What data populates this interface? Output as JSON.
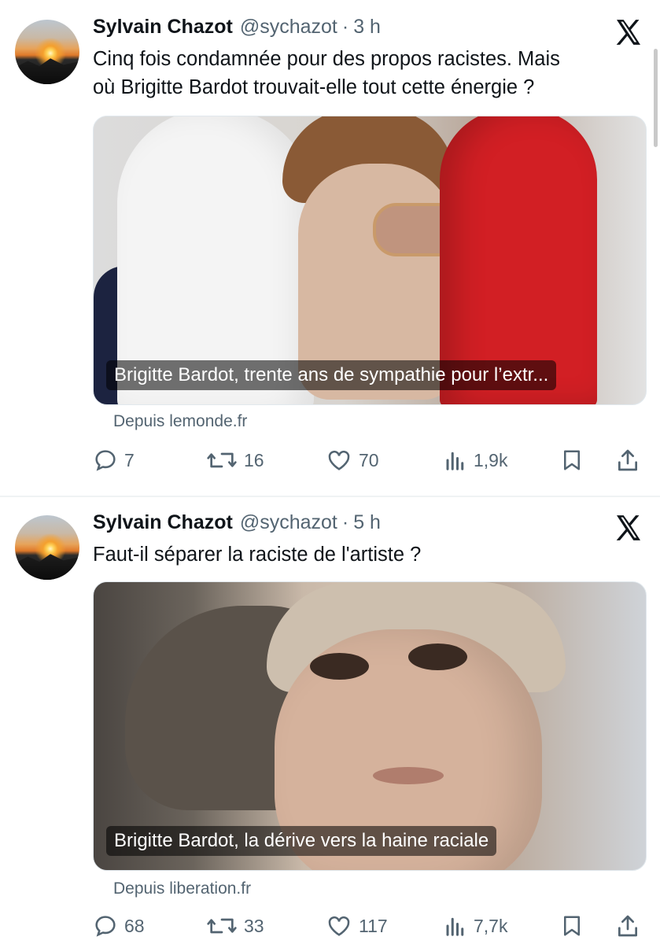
{
  "tweets": [
    {
      "author_name": "Sylvain Chazot",
      "handle": "@sychazot",
      "separator": "·",
      "time": "3 h",
      "text_line1": "Cinq fois condamnée pour des propos racistes. Mais",
      "text_line2": "où Brigitte Bardot trouvait-elle tout cette énergie ?",
      "media_caption": "Brigitte Bardot, trente ans de sympathie pour l’extr...",
      "source": "Depuis lemonde.fr",
      "replies": "7",
      "reposts": "16",
      "likes": "70",
      "views": "1,9k"
    },
    {
      "author_name": "Sylvain Chazot",
      "handle": "@sychazot",
      "separator": "·",
      "time": "5 h",
      "text_line1": "Faut-il séparer la raciste de l'artiste ?",
      "media_caption": "Brigitte Bardot, la dérive vers la haine raciale",
      "source": "Depuis liberation.fr",
      "replies": "68",
      "reposts": "33",
      "likes": "117",
      "views": "7,7k"
    }
  ],
  "colors": {
    "text_primary": "#0f1419",
    "text_secondary": "#536471",
    "divider": "#eff3f4"
  },
  "icons": [
    "x-logo-icon",
    "reply-icon",
    "repost-icon",
    "like-icon",
    "views-icon",
    "bookmark-icon",
    "share-icon"
  ]
}
